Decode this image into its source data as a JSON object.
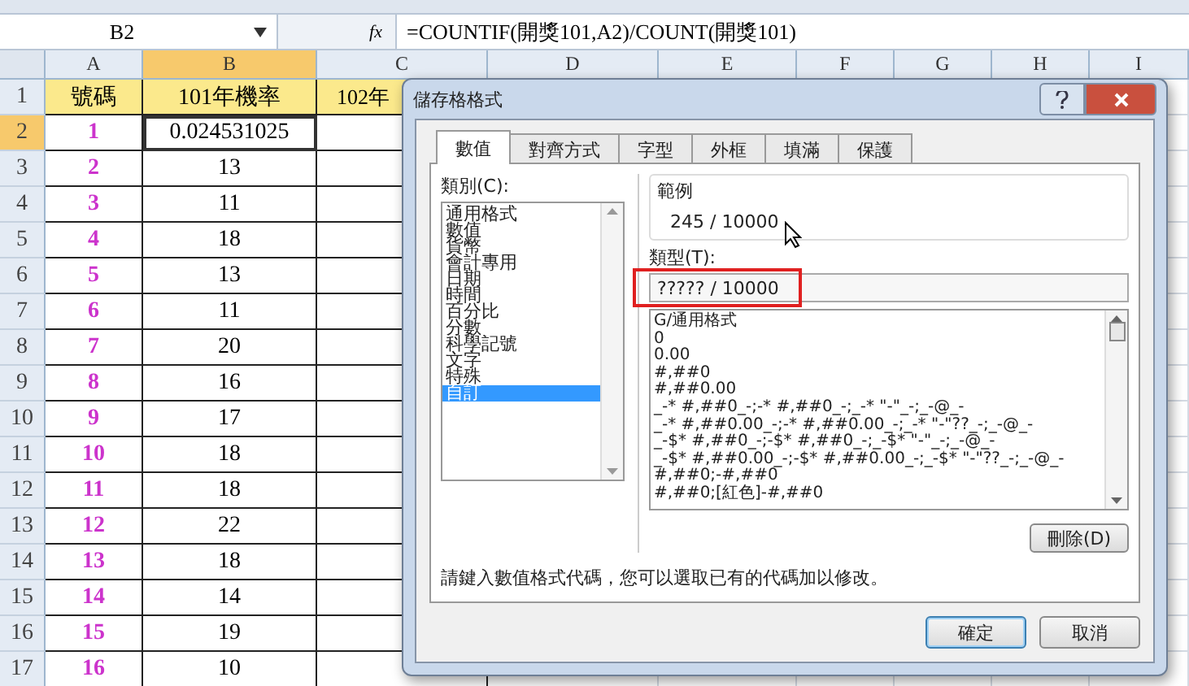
{
  "formula_bar": {
    "name_box": "B2",
    "function_label": "fx",
    "formula": "=COUNTIF(開獎101,A2)/COUNT(開獎101)"
  },
  "columns": [
    {
      "label": "A",
      "selected": false
    },
    {
      "label": "B",
      "selected": true
    },
    {
      "label": "C",
      "selected": false
    },
    {
      "label": "D",
      "selected": false
    },
    {
      "label": "E",
      "selected": false
    },
    {
      "label": "F",
      "selected": false
    },
    {
      "label": "G",
      "selected": false
    },
    {
      "label": "H",
      "selected": false
    },
    {
      "label": "I",
      "selected": false
    }
  ],
  "rows": [
    {
      "number": "1",
      "kind": "header",
      "selected": false,
      "cells": [
        "號碼",
        "101年機率",
        "102年"
      ]
    },
    {
      "number": "2",
      "kind": "data",
      "selected": true,
      "cells": [
        "1",
        "0.024531025"
      ]
    },
    {
      "number": "3",
      "kind": "data",
      "selected": false,
      "cells": [
        "2",
        "13"
      ]
    },
    {
      "number": "4",
      "kind": "data",
      "selected": false,
      "cells": [
        "3",
        "11"
      ]
    },
    {
      "number": "5",
      "kind": "data",
      "selected": false,
      "cells": [
        "4",
        "18"
      ]
    },
    {
      "number": "6",
      "kind": "data",
      "selected": false,
      "cells": [
        "5",
        "13"
      ]
    },
    {
      "number": "7",
      "kind": "data",
      "selected": false,
      "cells": [
        "6",
        "11"
      ]
    },
    {
      "number": "8",
      "kind": "data",
      "selected": false,
      "cells": [
        "7",
        "20"
      ]
    },
    {
      "number": "9",
      "kind": "data",
      "selected": false,
      "cells": [
        "8",
        "16"
      ]
    },
    {
      "number": "10",
      "kind": "data",
      "selected": false,
      "cells": [
        "9",
        "17"
      ]
    },
    {
      "number": "11",
      "kind": "data",
      "selected": false,
      "cells": [
        "10",
        "18"
      ]
    },
    {
      "number": "12",
      "kind": "data",
      "selected": false,
      "cells": [
        "11",
        "18"
      ]
    },
    {
      "number": "13",
      "kind": "data",
      "selected": false,
      "cells": [
        "12",
        "22"
      ]
    },
    {
      "number": "14",
      "kind": "data",
      "selected": false,
      "cells": [
        "13",
        "18"
      ]
    },
    {
      "number": "15",
      "kind": "data",
      "selected": false,
      "cells": [
        "14",
        "14"
      ]
    },
    {
      "number": "16",
      "kind": "data",
      "selected": false,
      "cells": [
        "15",
        "19"
      ]
    },
    {
      "number": "17",
      "kind": "data",
      "selected": false,
      "cells": [
        "16",
        "10"
      ]
    }
  ],
  "dialog": {
    "title": "儲存格格式",
    "tabs": [
      {
        "label": "數值",
        "selected": true
      },
      {
        "label": "對齊方式",
        "selected": false
      },
      {
        "label": "字型",
        "selected": false
      },
      {
        "label": "外框",
        "selected": false
      },
      {
        "label": "填滿",
        "selected": false
      },
      {
        "label": "保護",
        "selected": false
      }
    ],
    "category_label": "類別(C):",
    "categories": [
      {
        "label": "通用格式",
        "selected": false
      },
      {
        "label": "數值",
        "selected": false
      },
      {
        "label": "貨幣",
        "selected": false
      },
      {
        "label": "會計專用",
        "selected": false
      },
      {
        "label": "日期",
        "selected": false
      },
      {
        "label": "時間",
        "selected": false
      },
      {
        "label": "百分比",
        "selected": false
      },
      {
        "label": "分數",
        "selected": false
      },
      {
        "label": "科學記號",
        "selected": false
      },
      {
        "label": "文字",
        "selected": false
      },
      {
        "label": "特殊",
        "selected": false
      },
      {
        "label": "自訂",
        "selected": true
      }
    ],
    "sample_label": "範例",
    "sample_value": "245 / 10000",
    "type_label": "類型(T):",
    "type_value": "????? / 10000",
    "type_highlighted": true,
    "formats": [
      "G/通用格式",
      "0",
      "0.00",
      "#,##0",
      "#,##0.00",
      "_-* #,##0_-;-* #,##0_-;_-* \"-\"_-;_-@_-",
      "_-* #,##0.00_-;-* #,##0.00_-;_-* \"-\"??_-;_-@_-",
      "_-$* #,##0_-;-$* #,##0_-;_-$* \"-\"_-;_-@_-",
      "_-$* #,##0.00_-;-$* #,##0.00_-;_-$* \"-\"??_-;_-@_-",
      "#,##0;-#,##0",
      "#,##0;[紅色]-#,##0"
    ],
    "delete_button": "刪除(D)",
    "hint": "請鍵入數值格式代碼，您可以選取已有的代碼加以修改。",
    "buttons": [
      {
        "label": "確定",
        "default": true
      },
      {
        "label": "取消",
        "default": false
      }
    ]
  }
}
